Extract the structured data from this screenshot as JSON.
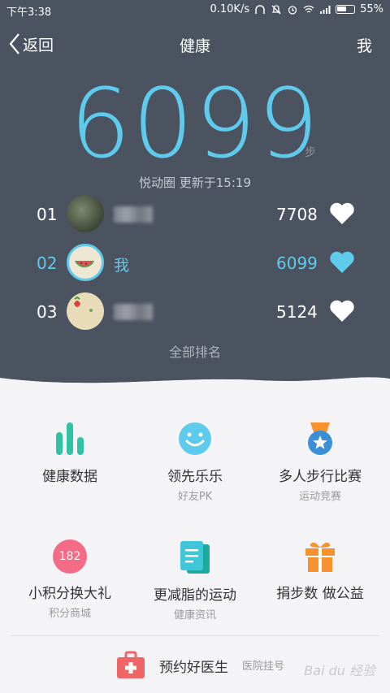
{
  "status_bar": {
    "time": "下午3:38",
    "speed": "0.10K/s",
    "battery": "55%"
  },
  "nav": {
    "back": "返回",
    "title": "健康",
    "me": "我"
  },
  "steps": {
    "value": "6099",
    "unit": "步",
    "update": "悦动圈 更新于15:19"
  },
  "ranking": [
    {
      "rank": "01",
      "name": "",
      "score": "7708",
      "liked": false
    },
    {
      "rank": "02",
      "name": "我",
      "score": "6099",
      "liked": true
    },
    {
      "rank": "03",
      "name": "",
      "score": "5124",
      "liked": false
    }
  ],
  "all_rank": "全部排名",
  "features": [
    {
      "title": "健康数据",
      "subtitle": "",
      "icon": "bar-chart-icon"
    },
    {
      "title": "领先乐乐",
      "subtitle": "好友PK",
      "icon": "smiley-icon"
    },
    {
      "title": "多人步行比赛",
      "subtitle": "运动竞赛",
      "icon": "medal-icon"
    },
    {
      "title": "小积分换大礼",
      "subtitle": "积分商城",
      "icon": "points-badge-icon",
      "badge": "182"
    },
    {
      "title": "更减脂的运动",
      "subtitle": "健康资讯",
      "icon": "document-icon"
    },
    {
      "title": "捐步数 做公益",
      "subtitle": "",
      "icon": "gift-icon"
    }
  ],
  "doctor": {
    "title": "预约好医生",
    "subtitle": "医院挂号",
    "icon": "medical-kit-icon"
  },
  "watermark": "Bai du 经验",
  "colors": {
    "accent": "#5fcbec",
    "header_bg": "#4b5260",
    "teal": "#2fc3a3",
    "pink": "#f36b87",
    "orange": "#f7922e",
    "red": "#ef6464"
  }
}
